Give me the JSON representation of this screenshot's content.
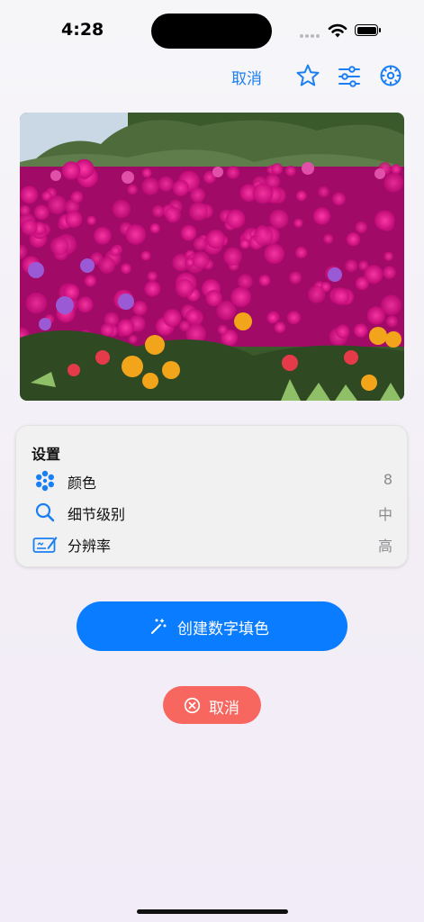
{
  "status_bar": {
    "time": "4:28"
  },
  "toolbar": {
    "cancel_label": "取消",
    "icons": [
      "star-icon",
      "sliders-icon",
      "gear-icon"
    ]
  },
  "photo": {
    "subject": "magenta-flower-field"
  },
  "settings": {
    "title": "设置",
    "rows": [
      {
        "icon": "palette-dots-icon",
        "label": "颜色",
        "value": "8"
      },
      {
        "icon": "magnifier-icon",
        "label": "细节级别",
        "value": "中"
      },
      {
        "icon": "signature-icon",
        "label": "分辨率",
        "value": "高"
      }
    ]
  },
  "create_button": {
    "label": "创建数字填色",
    "icon": "magic-wand-icon"
  },
  "cancel_button": {
    "label": "取消",
    "icon": "close-circle-icon"
  },
  "colors": {
    "accent": "#0a7cff",
    "cancel": "#f7675f",
    "link": "#1a7ff2"
  }
}
